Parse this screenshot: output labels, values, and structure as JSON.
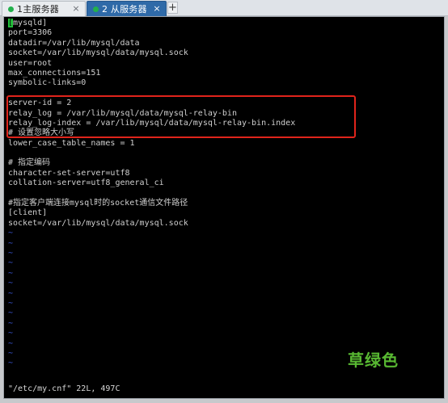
{
  "tabs": [
    {
      "label": "1主服务器",
      "close": "×",
      "active": false
    },
    {
      "label": "2 从服务器",
      "close": "×",
      "active": true
    }
  ],
  "tab_add": "+",
  "colors": {
    "tab_active": "#2f6aa8",
    "dot": "#22b14c",
    "highlight": "#e0241b",
    "tilde": "#3b56d8",
    "watermark": "#58b832"
  },
  "editor": {
    "cursor_char": "[",
    "first_line_rest": "mysqld]",
    "lines": [
      "port=3306",
      "datadir=/var/lib/mysql/data",
      "socket=/var/lib/mysql/data/mysql.sock",
      "user=root",
      "max_connections=151",
      "symbolic-links=0",
      "",
      "server-id = 2",
      "relay_log = /var/lib/mysql/data/mysql-relay-bin",
      "relay_log-index = /var/lib/mysql/data/mysql-relay-bin.index",
      "# 设置忽略大小写",
      "lower_case_table_names = 1",
      "",
      "# 指定编码",
      "character-set-server=utf8",
      "collation-server=utf8_general_ci",
      "",
      "#指定客户端连接mysql时的socket通信文件路径",
      "[client]",
      "socket=/var/lib/mysql/data/mysql.sock"
    ],
    "tilde": "~",
    "status": "\"/etc/my.cnf\" 22L, 497C"
  },
  "watermark": "草绿色"
}
